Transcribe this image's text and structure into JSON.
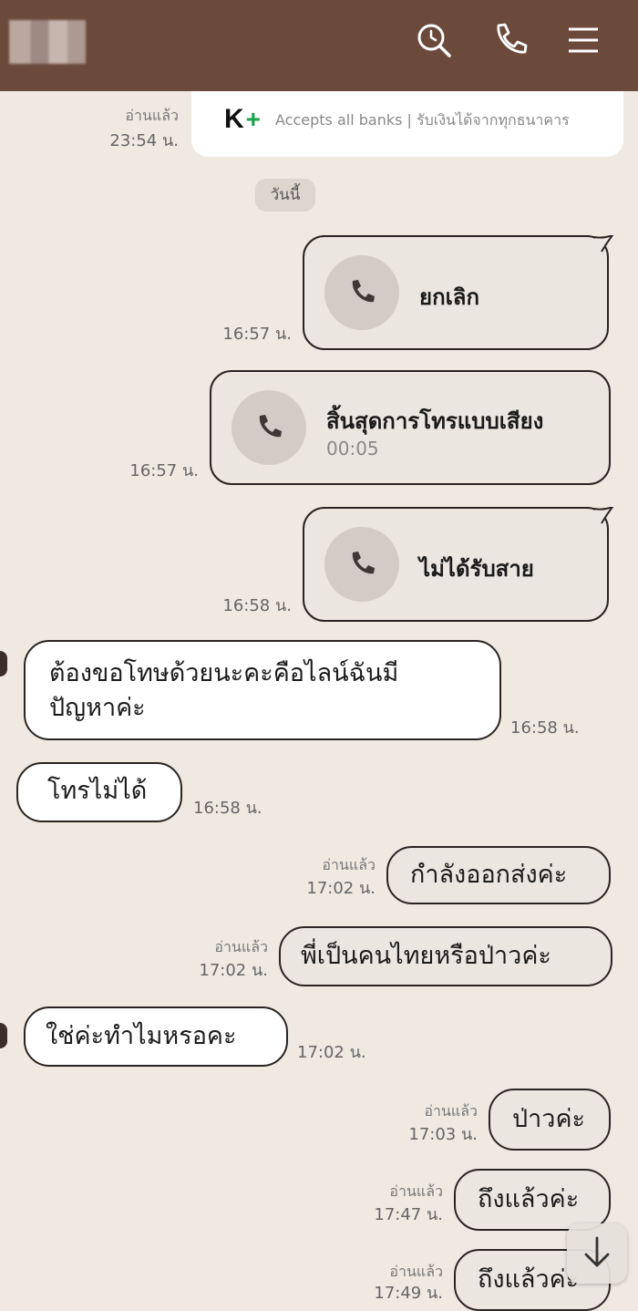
{
  "header": {
    "icons": {
      "search": "search-icon",
      "call": "phone-icon",
      "menu": "menu-icon"
    }
  },
  "banner": {
    "logo_k": "K",
    "logo_plus": "+",
    "text": "Accepts all banks | รับเงินได้จากทุกธนาคาร",
    "read": "อ่านแล้ว",
    "time": "23:54 น."
  },
  "date_divider": "วันนี้",
  "calls": [
    {
      "title": "ยกเลิก",
      "sub": "",
      "time": "16:57 น."
    },
    {
      "title": "สิ้นสุดการโทรแบบเสียง",
      "sub": "00:05",
      "time": "16:57 น."
    },
    {
      "title": "ไม่ได้รับสาย",
      "sub": "",
      "time": "16:58 น."
    }
  ],
  "messages": [
    {
      "dir": "in",
      "line1": "ต้องขอโทษด้วยนะคะคือไลน์ฉันมี",
      "line2": "ปัญหาค่ะ",
      "time": "16:58 น."
    },
    {
      "dir": "in",
      "text": "โทรไม่ได้",
      "time": "16:58 น."
    },
    {
      "dir": "out",
      "text": "กำลังออกส่งค่ะ",
      "read": "อ่านแล้ว",
      "time": "17:02 น."
    },
    {
      "dir": "out",
      "text": "พี่เป็นคนไทยหรือป่าวค่ะ",
      "read": "อ่านแล้ว",
      "time": "17:02 น."
    },
    {
      "dir": "in",
      "text": "ใช่ค่ะทำไมหรอคะ",
      "time": "17:02 น."
    },
    {
      "dir": "out",
      "text": "ป่าวค่ะ",
      "read": "อ่านแล้ว",
      "time": "17:03 น."
    },
    {
      "dir": "out",
      "text": "ถึงแล้วค่ะ",
      "read": "อ่านแล้ว",
      "time": "17:47 น."
    },
    {
      "dir": "out",
      "text": "ถึงแล้วค่ะ",
      "read": "อ่านแล้ว",
      "time": "17:49 น."
    }
  ],
  "colors": {
    "header": "#6b4a3b",
    "background": "#efe9e2",
    "outgoing": "#ece6e1",
    "incoming": "#ffffff",
    "kplus_green": "#1aa34a"
  },
  "scroll_button": {
    "icon": "arrow-down-icon"
  }
}
